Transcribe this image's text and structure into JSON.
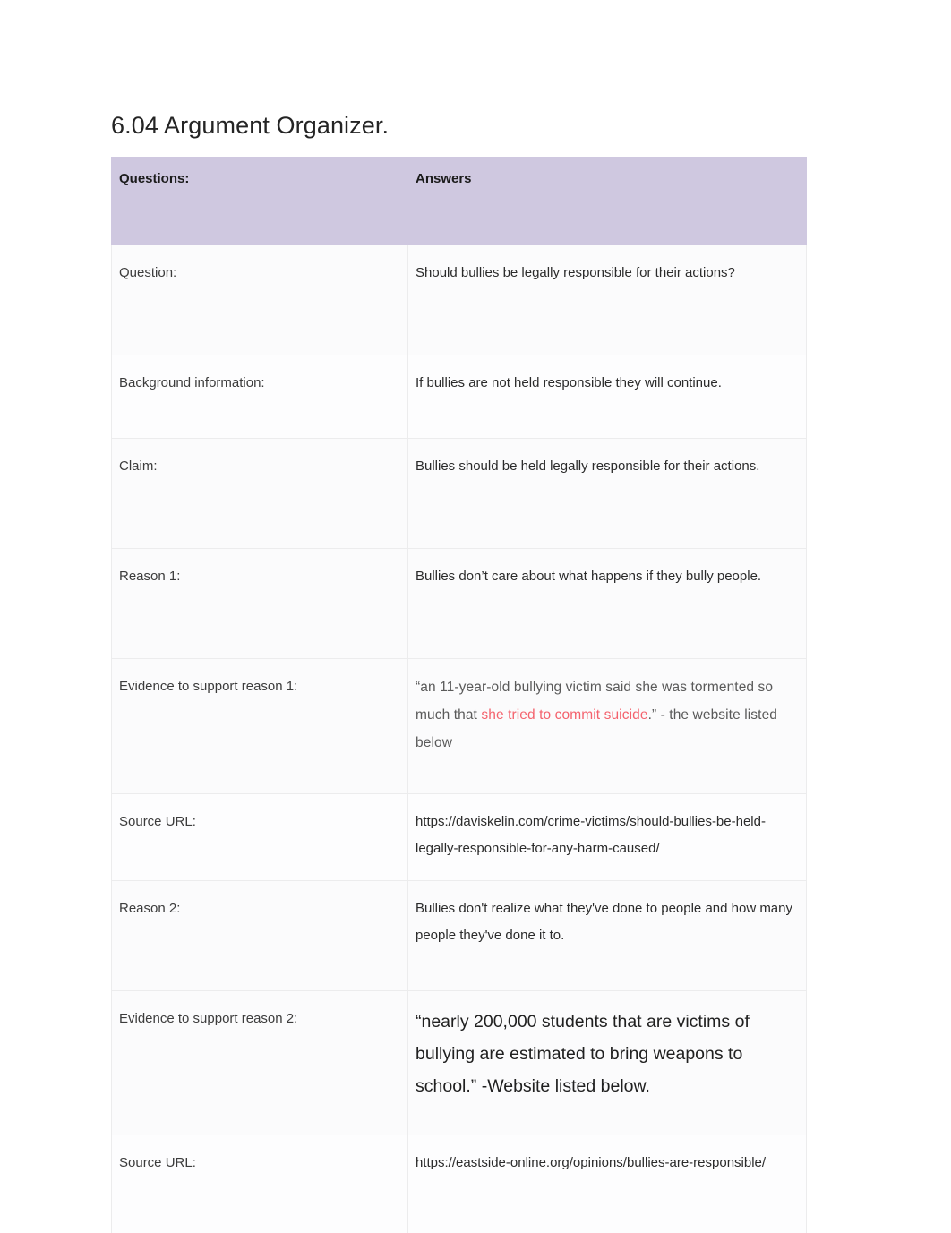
{
  "document": {
    "title": "6.04 Argument Organizer."
  },
  "table": {
    "headers": {
      "questions": "Questions:",
      "answers": "Answers"
    },
    "rows": [
      {
        "label": "Question:",
        "answer": "Should bullies be legally responsible for their actions?"
      },
      {
        "label": "Background information:",
        "answer": " If bullies are not held responsible they will continue."
      },
      {
        "label": "Claim:",
        "answer": " Bullies should be held legally responsible for their actions."
      },
      {
        "label": "Reason 1:",
        "answer": "Bullies don’t care about what happens if they bully people."
      },
      {
        "label": "Evidence to support reason 1:",
        "answer_part_1": "“an 11-year-old bullying victim said she was tormented so much that ",
        "answer_highlight": "she tried to commit suicide",
        "answer_part_2": ".” - the website listed below",
        "highlight_color": "#f4626d"
      },
      {
        "label": "Source URL:",
        "answer": "https://daviskelin.com/crime-victims/should-bullies-be-held-legally-responsible-for-any-harm-caused/"
      },
      {
        "label": "Reason 2:",
        "answer": "Bullies don't realize what they've done to people and how many people they've done it to."
      },
      {
        "label": "Evidence to support reason 2:",
        "answer": "“nearly 200,000 students that are victims of bullying are estimated to bring weapons to school.” -Website listed below."
      },
      {
        "label": "Source URL:",
        "answer": "https://eastside-online.org/opinions/bullies-are-responsible/"
      }
    ]
  },
  "colors": {
    "header_background": "#cfc8e0",
    "highlight_red": "#f4626d",
    "body_text": "#2b2b2b",
    "label_text": "#3c3c3c"
  }
}
